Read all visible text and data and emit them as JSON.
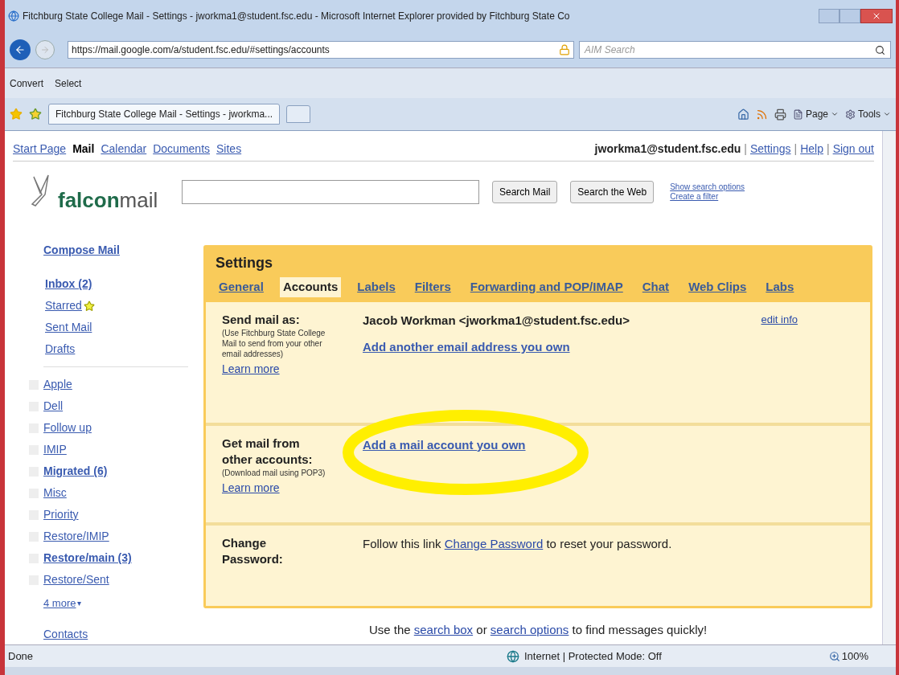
{
  "window": {
    "title": "Fitchburg State College Mail - Settings - jworkma1@student.fsc.edu - Microsoft Internet Explorer provided by Fitchburg State Co"
  },
  "address_bar": {
    "url": "https://mail.google.com/a/student.fsc.edu/#settings/accounts",
    "search_placeholder": "AIM Search"
  },
  "toolbar": [
    "Convert",
    "Select"
  ],
  "tabs": [
    {
      "label": "Fitchburg State College Mail - Settings - jworkma...",
      "selected": true
    }
  ],
  "command_bar": [
    "Page",
    "Tools"
  ],
  "top_nav": [
    {
      "label": "Start Page",
      "selected": false
    },
    {
      "label": "Mail",
      "selected": true
    },
    {
      "label": "Calendar",
      "selected": false
    },
    {
      "label": "Documents",
      "selected": false
    },
    {
      "label": "Sites",
      "selected": false
    }
  ],
  "account": {
    "email": "jworkma1@student.fsc.edu",
    "separator": "|",
    "links": [
      "Settings",
      "Help",
      "Sign out"
    ]
  },
  "logo": {
    "bold": "falcon",
    "light": "mail"
  },
  "search": {
    "buttons": [
      "Search Mail",
      "Search the Web"
    ],
    "links": [
      "Show search options",
      "Create a filter"
    ]
  },
  "sidebar": {
    "compose": "Compose Mail",
    "folders": [
      {
        "label": "Inbox (2)",
        "unread": true,
        "starred": false
      },
      {
        "label": "Starred",
        "unread": false,
        "starred": true
      },
      {
        "label": "Sent Mail",
        "unread": false,
        "starred": false
      },
      {
        "label": "Drafts",
        "unread": false,
        "starred": false
      }
    ],
    "labels": [
      {
        "label": "Apple",
        "unread": false
      },
      {
        "label": "Dell",
        "unread": false
      },
      {
        "label": "Follow up",
        "unread": false
      },
      {
        "label": "IMIP",
        "unread": false
      },
      {
        "label": "Migrated (6)",
        "unread": true
      },
      {
        "label": "Misc",
        "unread": false
      },
      {
        "label": "Priority",
        "unread": false
      },
      {
        "label": "Restore/IMIP",
        "unread": false
      },
      {
        "label": "Restore/main (3)",
        "unread": true
      },
      {
        "label": "Restore/Sent",
        "unread": false
      }
    ],
    "more": "4 more",
    "more_caret": "▾",
    "contacts": "Contacts"
  },
  "settings": {
    "title": "Settings",
    "tabs": [
      {
        "label": "General",
        "selected": false
      },
      {
        "label": "Accounts",
        "selected": true
      },
      {
        "label": "Labels",
        "selected": false
      },
      {
        "label": "Filters",
        "selected": false
      },
      {
        "label": "Forwarding and POP/IMAP",
        "selected": false
      },
      {
        "label": "Chat",
        "selected": false
      },
      {
        "label": "Web Clips",
        "selected": false
      },
      {
        "label": "Labs",
        "selected": false
      }
    ],
    "sections": [
      {
        "label": "Send mail as:",
        "note": "(Use Fitchburg State College Mail to send from your other email addresses)",
        "learn_more": "Learn more",
        "value": "Jacob Workman <jworkma1@student.fsc.edu>",
        "link": "Add another email address you own",
        "action": "edit info",
        "highlighted": false
      },
      {
        "label": "Get mail from other accounts:",
        "note": "(Download mail using POP3)",
        "learn_more": "Learn more",
        "link": "Add a mail account you own",
        "highlighted": true
      },
      {
        "label": "Change Password:",
        "sentence": {
          "texts": [
            "Follow this link",
            "to reset your password."
          ],
          "links": [
            "Change Password"
          ]
        },
        "highlighted": false
      }
    ]
  },
  "footer": {
    "texts": [
      "Use the",
      "or",
      "to find messages quickly!"
    ],
    "links": [
      "search box",
      "search options"
    ]
  },
  "status_bar": {
    "status": "Done",
    "zone": "Internet | Protected Mode: Off",
    "zoom": "100%"
  }
}
